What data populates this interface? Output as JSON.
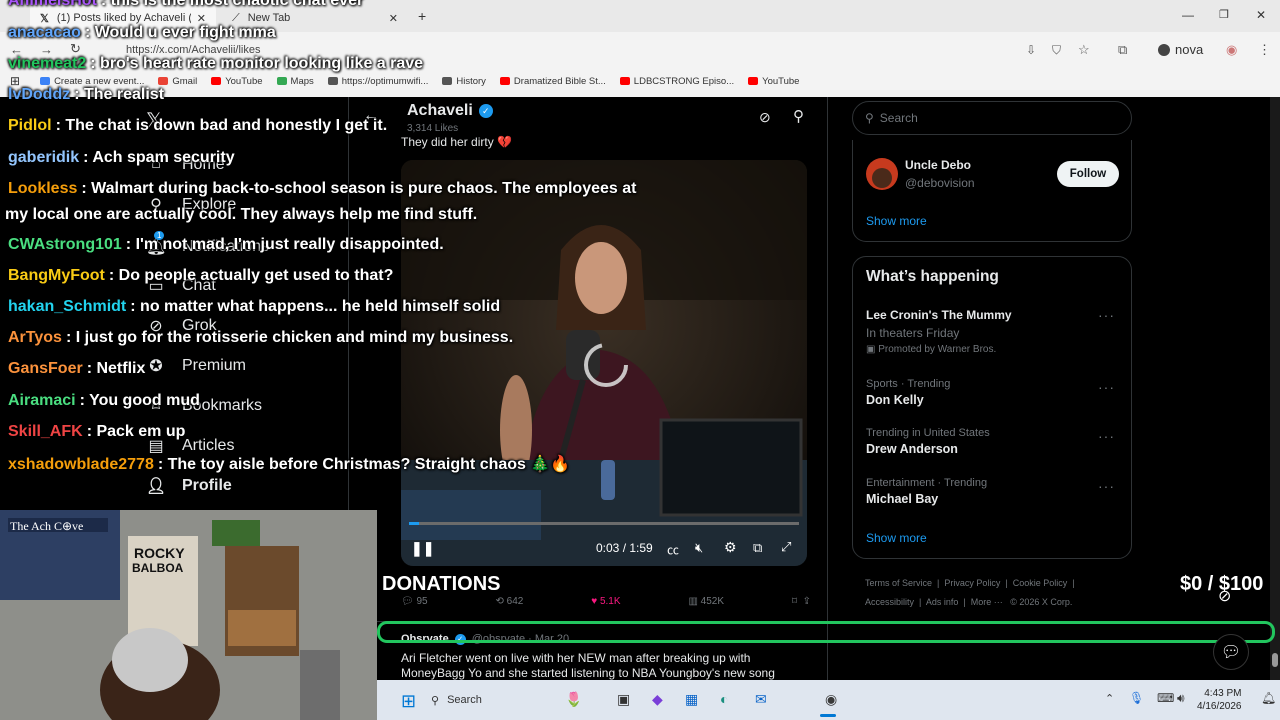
{
  "browser": {
    "tabs": [
      {
        "title": "(1) Posts liked by Achaveli (@A",
        "active": true
      },
      {
        "title": "New Tab",
        "active": false
      }
    ],
    "url": "https://x.com/Achavelii/likes",
    "profile_name": "nova",
    "bookmarks": [
      {
        "label": "Create a new event...",
        "color": "#3b82f6"
      },
      {
        "label": "Gmail",
        "color": "#ea4335"
      },
      {
        "label": "YouTube",
        "color": "#ff0000"
      },
      {
        "label": "Maps",
        "color": "#34a853"
      },
      {
        "label": "https://optimumwifi...",
        "color": "#555555"
      },
      {
        "label": "History",
        "color": "#555555"
      },
      {
        "label": "Dramatized Bible St...",
        "color": "#ff0000"
      },
      {
        "label": "LDBCSTRONG Episo...",
        "color": "#ff0000"
      },
      {
        "label": "YouTube",
        "color": "#ff0000"
      }
    ]
  },
  "xnav": {
    "items": [
      {
        "label": "Home",
        "icon": "home-icon"
      },
      {
        "label": "Explore",
        "icon": "search-icon"
      },
      {
        "label": "Notifications",
        "icon": "bell-icon",
        "badge": "1"
      },
      {
        "label": "Chat",
        "icon": "chat-icon"
      },
      {
        "label": "Grok",
        "icon": "grok-icon"
      },
      {
        "label": "Premium",
        "icon": "premium-icon"
      },
      {
        "label": "Bookmarks",
        "icon": "bookmark-icon"
      },
      {
        "label": "Articles",
        "icon": "article-icon"
      },
      {
        "label": "Profile",
        "icon": "profile-icon"
      }
    ]
  },
  "feed": {
    "header_name": "Achaveli",
    "header_sub": "3,314 Likes",
    "post_text": "They did her dirty 💔",
    "video_time": "0:03 / 1:59",
    "actions": {
      "replies": "95",
      "reposts": "642",
      "likes": "5.1K",
      "views": "452K"
    },
    "next_post": {
      "author": "Obsrvate",
      "handle_date": "@obsrvate · Mar 20",
      "text": "Ari Fletcher went on live with her NEW man after breaking up with MoneyBagg Yo and she started listening to NBA Youngboy's new song"
    }
  },
  "sidebar": {
    "search_placeholder": "Search",
    "follow": {
      "name": "Uncle Debo",
      "handle": "@debovision",
      "button": "Follow"
    },
    "show_more_1": "Show more",
    "happening_title": "What’s happening",
    "trends": [
      {
        "title": "Lee Cronin's The Mummy",
        "meta": "In theaters Friday",
        "promo": "Promoted by Warner Bros."
      },
      {
        "meta": "Sports · Trending",
        "title": "Don Kelly"
      },
      {
        "meta": "Trending in United States",
        "title": "Drew Anderson"
      },
      {
        "meta": "Entertainment · Trending",
        "title": "Michael Bay"
      }
    ],
    "show_more_2": "Show more",
    "footer": [
      "Terms of Service",
      "Privacy Policy",
      "Cookie Policy",
      "Accessibility",
      "Ads info",
      "More ···",
      "© 2026 X Corp."
    ]
  },
  "overlay": {
    "chat": [
      {
        "user": "AnimeIsHot",
        "text": ": this is the most chaotic chat ever",
        "color": "#a855f7"
      },
      {
        "user": "anacacao",
        "text": ": Would u ever fight mma",
        "color": "#60a5fa"
      },
      {
        "user": "vinemeat2",
        "text": ": bro's heart rate monitor looking like a rave",
        "color": "#22c55e"
      },
      {
        "user": "lvDoddz",
        "text": ": The realist",
        "color": "#60a5fa"
      },
      {
        "user": "Pidlol",
        "text": ": The chat is down bad and honestly I get it.",
        "color": "#facc15"
      },
      {
        "user": "gaberidik",
        "text": ": Ach spam security",
        "color": "#93c5fd"
      },
      {
        "user": "Lookless",
        "text": ": Walmart during back-to-school season is pure chaos. The employees at",
        "color": "#f59e0b"
      },
      {
        "user": "",
        "text": "my local one are actually cool. They always help me find stuff.",
        "color": "#ffffff"
      },
      {
        "user": "CWAstrong101",
        "text": ": I'm not mad, I'm just really disappointed.",
        "color": "#4ade80"
      },
      {
        "user": "BangMyFoot",
        "text": ": Do people actually get used to that?",
        "color": "#facc15"
      },
      {
        "user": "hakan_Schmidt",
        "text": ": no matter what happens... he held himself solid",
        "color": "#22d3ee"
      },
      {
        "user": "ArTyos",
        "text": ": I just go for the rotisserie chicken and mind my business.",
        "color": "#fb923c"
      },
      {
        "user": "GansFoer",
        "text": ": Netflix",
        "color": "#fb923c"
      },
      {
        "user": "Airamaci",
        "text": ": You good mud",
        "color": "#4ade80"
      },
      {
        "user": "Skill_AFK",
        "text": ": Pack em up",
        "color": "#ef4444"
      },
      {
        "user": "xshadowblade2778",
        "text": ": The toy aisle before Christmas? Straight chaos 🎄🔥",
        "color": "#f59e0b"
      }
    ],
    "donations_label": "DONATIONS",
    "donations_amount": "$0 / $100"
  },
  "taskbar": {
    "search": "Search",
    "time": "4:43 PM",
    "date": "4/16/2026"
  },
  "colors": {
    "accent": "#1d9bf0",
    "like": "#f91880",
    "overlay_frame": "#22c55e"
  }
}
